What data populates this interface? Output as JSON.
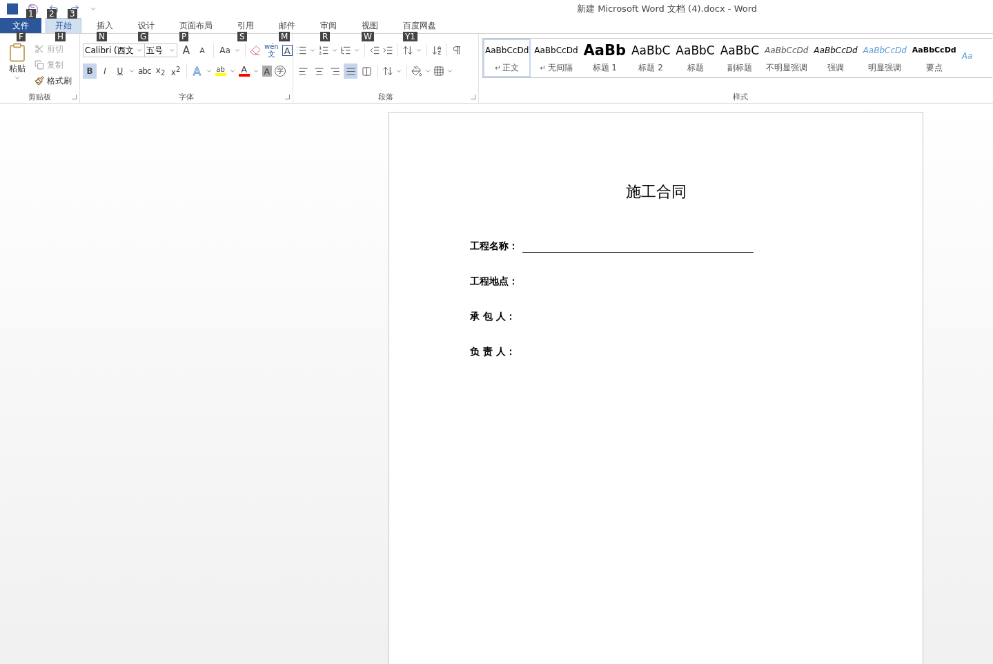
{
  "quick_access": {
    "keytips": [
      "1",
      "2",
      "3"
    ]
  },
  "window": {
    "title": "新建 Microsoft Word 文档 (4).docx - Word"
  },
  "tabs": [
    {
      "label": "文件",
      "keytip": "F",
      "kind": "file",
      "selected": false
    },
    {
      "label": "开始",
      "keytip": "H",
      "kind": "tab",
      "selected": true
    },
    {
      "label": "插入",
      "keytip": "N",
      "kind": "tab",
      "selected": false
    },
    {
      "label": "设计",
      "keytip": "G",
      "kind": "tab",
      "selected": false
    },
    {
      "label": "页面布局",
      "keytip": "P",
      "kind": "tab",
      "selected": false
    },
    {
      "label": "引用",
      "keytip": "S",
      "kind": "tab",
      "selected": false
    },
    {
      "label": "邮件",
      "keytip": "M",
      "kind": "tab",
      "selected": false
    },
    {
      "label": "审阅",
      "keytip": "R",
      "kind": "tab",
      "selected": false
    },
    {
      "label": "视图",
      "keytip": "W",
      "kind": "tab",
      "selected": false
    },
    {
      "label": "百度网盘",
      "keytip": "Y1",
      "kind": "tab",
      "selected": false
    }
  ],
  "clipboard": {
    "paste": "粘贴",
    "group": "剪贴板",
    "items": [
      {
        "kind": "cut",
        "label": "剪切",
        "disabled": true
      },
      {
        "kind": "copy",
        "label": "复制",
        "disabled": true
      },
      {
        "kind": "painter",
        "label": "格式刷",
        "disabled": false
      }
    ]
  },
  "font": {
    "group": "字体",
    "name": "Calibri (西文",
    "size": "五号",
    "tools": [
      {
        "kind": "grow",
        "label": "A"
      },
      {
        "kind": "shrink",
        "label": "A"
      },
      {
        "kind": "case",
        "label": "Aa"
      },
      {
        "kind": "clear"
      },
      {
        "kind": "phonetic",
        "label": "wén",
        "sub": "文"
      },
      {
        "kind": "border",
        "label": "A"
      }
    ],
    "formats": [
      {
        "label": "B",
        "kind": "bold",
        "selected": true
      },
      {
        "label": "I",
        "kind": "italic",
        "selected": false
      },
      {
        "label": "U",
        "kind": "underline",
        "selected": false
      },
      {
        "label": "abc",
        "kind": "strike",
        "selected": false
      },
      {
        "label": "x$_{2}$",
        "kind": "plain",
        "selected": false
      },
      {
        "label": "x$^{2}$",
        "kind": "plain",
        "selected": false
      }
    ],
    "effects": [
      {
        "kind": "effect",
        "label": "A"
      },
      {
        "kind": "highlight",
        "label": "ab",
        "color": "#ffff00"
      },
      {
        "kind": "fontcolor",
        "label": "A",
        "color": "#ff0000"
      },
      {
        "kind": "shade",
        "label": "A"
      },
      {
        "kind": "enclose",
        "label": "字"
      }
    ]
  },
  "paragraph": {
    "group": "段落",
    "aligns": [
      {
        "kind": "left",
        "selected": false
      },
      {
        "kind": "center",
        "selected": false
      },
      {
        "kind": "right",
        "selected": false
      },
      {
        "kind": "justify",
        "selected": true
      },
      {
        "kind": "distribute",
        "selected": false
      }
    ]
  },
  "styles": {
    "group": "样式",
    "items": [
      {
        "sample": "AaBbCcDd",
        "label": "正文",
        "kind": "normal",
        "mark": "↵",
        "selected": true
      },
      {
        "sample": "AaBbCcDd",
        "label": "无间隔",
        "kind": "normal",
        "mark": "↵",
        "selected": false
      },
      {
        "sample": "AaBb",
        "label": "标题 1",
        "kind": "heading1",
        "selected": false
      },
      {
        "sample": "AaBbC",
        "label": "标题 2",
        "kind": "heading",
        "selected": false
      },
      {
        "sample": "AaBbC",
        "label": "标题",
        "kind": "heading",
        "selected": false
      },
      {
        "sample": "AaBbC",
        "label": "副标题",
        "kind": "heading",
        "selected": false
      },
      {
        "sample": "AaBbCcDd",
        "label": "不明显强调",
        "kind": "subtle",
        "selected": false
      },
      {
        "sample": "AaBbCcDd",
        "label": "强调",
        "kind": "emphasis",
        "selected": false
      },
      {
        "sample": "AaBbCcDd",
        "label": "明显强调",
        "kind": "intense",
        "selected": false
      },
      {
        "sample": "AaBbCcDd",
        "label": "要点",
        "kind": "strong",
        "selected": false
      },
      {
        "sample": "Aa",
        "kind": "intense",
        "selected": false
      }
    ]
  },
  "document": {
    "title": "施工合同",
    "fields": [
      {
        "label": "工程名称：",
        "blank_line": true
      },
      {
        "label": "工程地点：",
        "blank_line": false
      },
      {
        "label": "承 包 人：",
        "blank_line": false
      },
      {
        "label": "负 责 人：",
        "blank_line": false
      }
    ]
  }
}
